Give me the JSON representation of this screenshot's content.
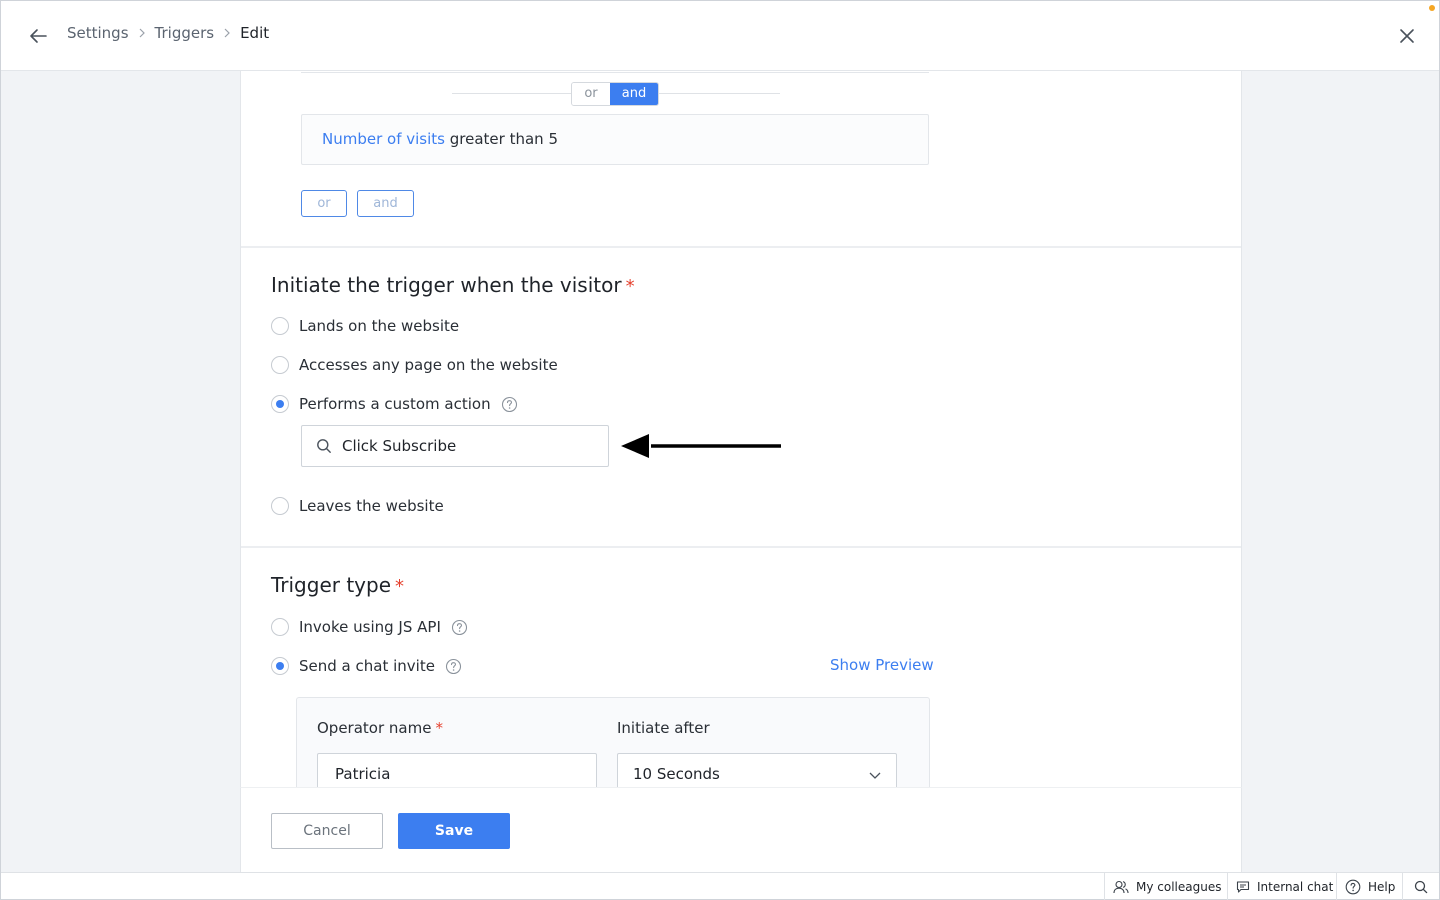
{
  "header": {
    "breadcrumbs": [
      "Settings",
      "Triggers",
      "Edit"
    ]
  },
  "conditions": {
    "join_toggle": {
      "or_label": "or",
      "and_label": "and",
      "selected": "and"
    },
    "criteria": {
      "field": "Number of visits",
      "rest": "greater than 5"
    },
    "add_buttons": {
      "or_label": "or",
      "and_label": "and"
    }
  },
  "initiate": {
    "title": "Initiate the trigger when the visitor",
    "required_mark": "*",
    "options": [
      {
        "label": "Lands on the website",
        "checked": false
      },
      {
        "label": "Accesses any page on the website",
        "checked": false
      },
      {
        "label": "Performs a custom action",
        "checked": true
      },
      {
        "label": "Leaves the website",
        "checked": false
      }
    ],
    "custom_action_value": "Click Subscribe"
  },
  "trigger_type": {
    "title": "Trigger type",
    "required_mark": "*",
    "options": [
      {
        "label": "Invoke using JS API",
        "checked": false
      },
      {
        "label": "Send a chat invite",
        "checked": true
      }
    ],
    "show_preview": "Show Preview",
    "operator_label": "Operator name",
    "operator_required_mark": "*",
    "operator_value": "Patricia",
    "initiate_after_label": "Initiate after",
    "initiate_after_value": "10 Seconds"
  },
  "footer": {
    "cancel_label": "Cancel",
    "save_label": "Save"
  },
  "statusbar": {
    "colleagues": "My colleagues",
    "internal_chat": "Internal chat",
    "help": "Help"
  },
  "colors": {
    "accent": "#3c7ef0",
    "required": "#e5412e",
    "notification": "#f5a623"
  }
}
